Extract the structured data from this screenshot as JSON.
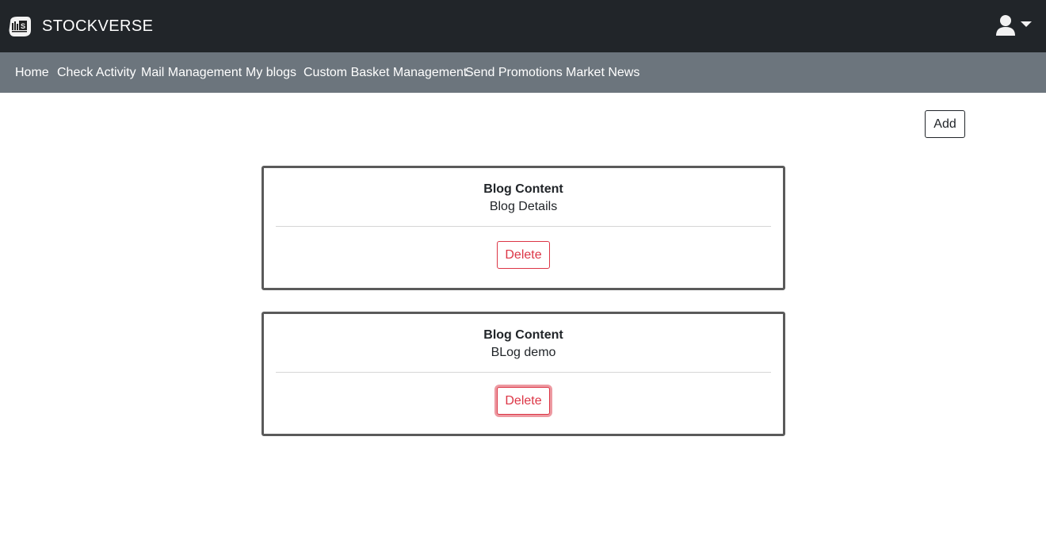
{
  "header": {
    "brand_name": "STOCKVERSE",
    "logo_icon": "stockverse-logo-icon",
    "user_icon": "user-icon",
    "dropdown_icon": "caret-down-icon"
  },
  "nav": {
    "items": [
      {
        "label": "Home"
      },
      {
        "label": "Check Activity"
      },
      {
        "label": "Mail Management"
      },
      {
        "label": "My blogs"
      },
      {
        "label": "Custom Basket Management"
      },
      {
        "label": "Send Promotions"
      },
      {
        "label": "Market News"
      }
    ]
  },
  "main": {
    "add_label": "Add",
    "blogs": [
      {
        "title": "Blog Content",
        "text": "Blog Details",
        "delete_label": "Delete"
      },
      {
        "title": "Blog Content",
        "text": "BLog demo",
        "delete_label": "Delete"
      }
    ]
  },
  "colors": {
    "header_bg": "#212529",
    "nav_bg": "#6c757d",
    "danger": "#dc3545"
  }
}
